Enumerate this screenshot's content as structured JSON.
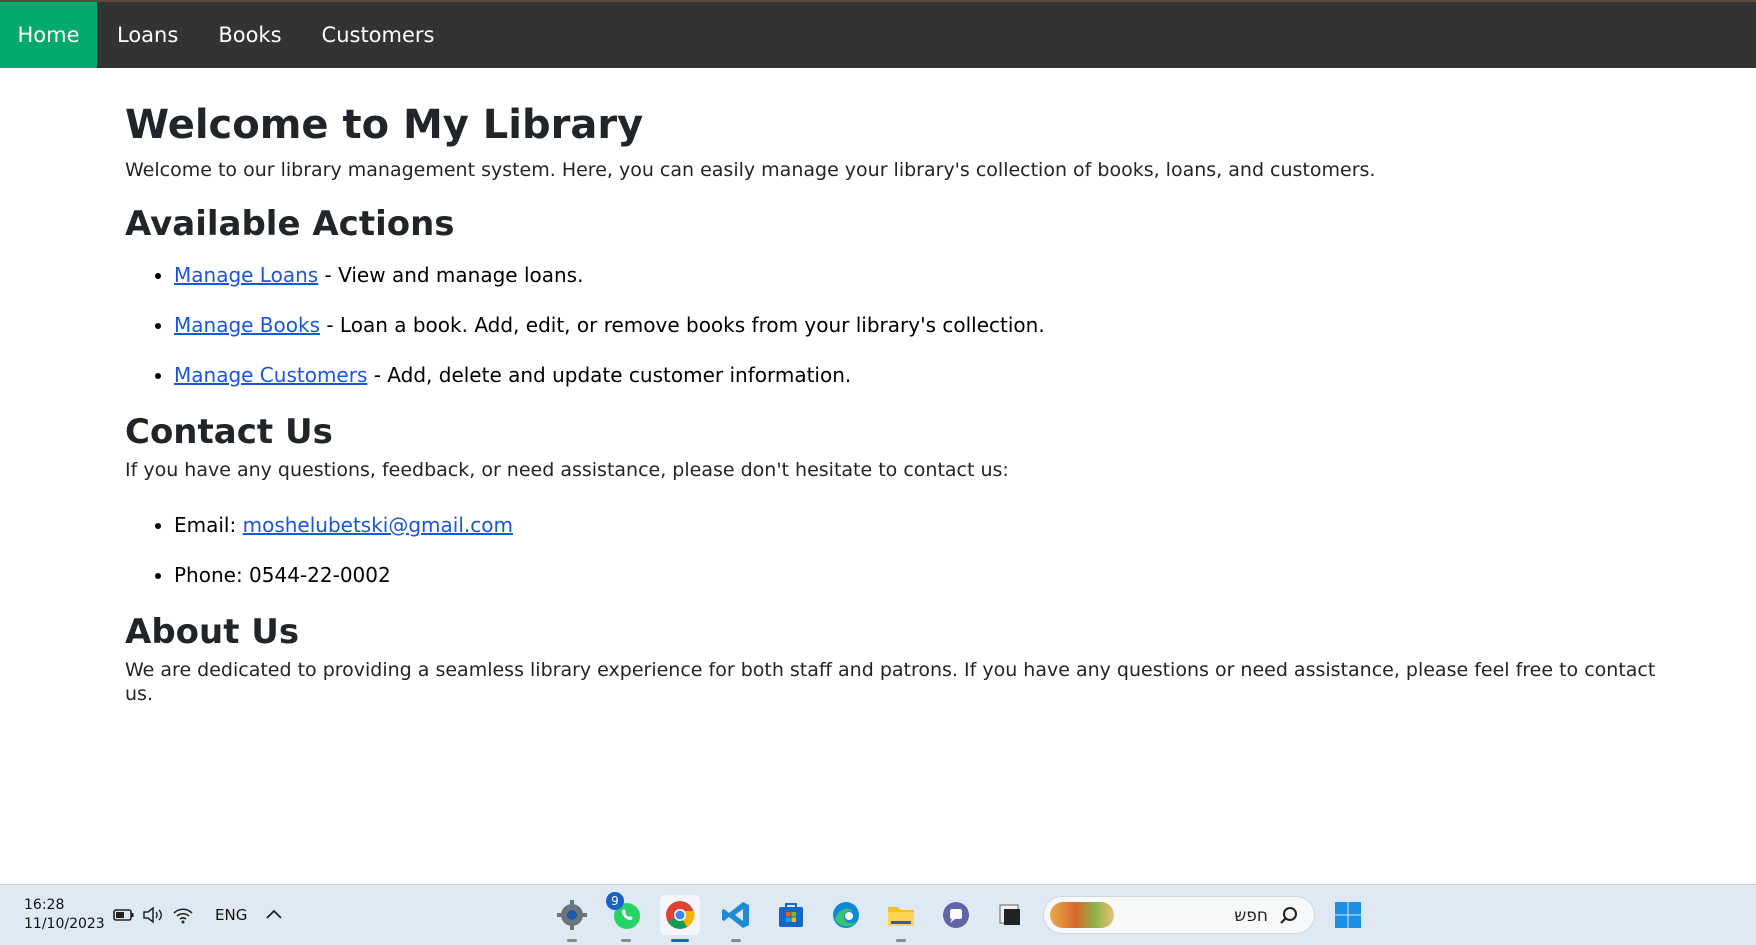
{
  "navbar": {
    "items": [
      {
        "label": "Home",
        "active": true
      },
      {
        "label": "Loans",
        "active": false
      },
      {
        "label": "Books",
        "active": false
      },
      {
        "label": "Customers",
        "active": false
      }
    ],
    "active_color": "#04aa6d",
    "background": "#333333"
  },
  "main": {
    "title": "Welcome to My Library",
    "intro": "Welcome to our library management system. Here, you can easily manage your library's collection of books, loans, and customers.",
    "actions": {
      "heading": "Available Actions",
      "items": [
        {
          "link": "Manage Loans",
          "text": " - View and manage loans."
        },
        {
          "link": "Manage Books",
          "text": " - Loan a book. Add, edit, or remove books from your library's collection."
        },
        {
          "link": "Manage Customers",
          "text": " - Add, delete and update customer information."
        }
      ]
    },
    "contact": {
      "heading": "Contact Us",
      "intro": "If you have any questions, feedback, or need assistance, please don't hesitate to contact us:",
      "email_label": "Email: ",
      "email": "moshelubetski@gmail.com",
      "phone": "Phone: 0544-22-0002"
    },
    "about": {
      "heading": "About Us",
      "text": "We are dedicated to providing a seamless library experience for both staff and patrons. If you have any questions or need assistance, please feel free to contact us."
    }
  },
  "taskbar": {
    "time": "16:28",
    "date": "11/10/2023",
    "language": "ENG",
    "whatsapp_badge": "9",
    "search_text": "חפש",
    "apps": [
      "settings-icon",
      "whatsapp-icon",
      "chrome-icon",
      "vscode-icon",
      "store-icon",
      "edge-icon",
      "file-explorer-icon",
      "teams-icon",
      "window-icon"
    ]
  }
}
